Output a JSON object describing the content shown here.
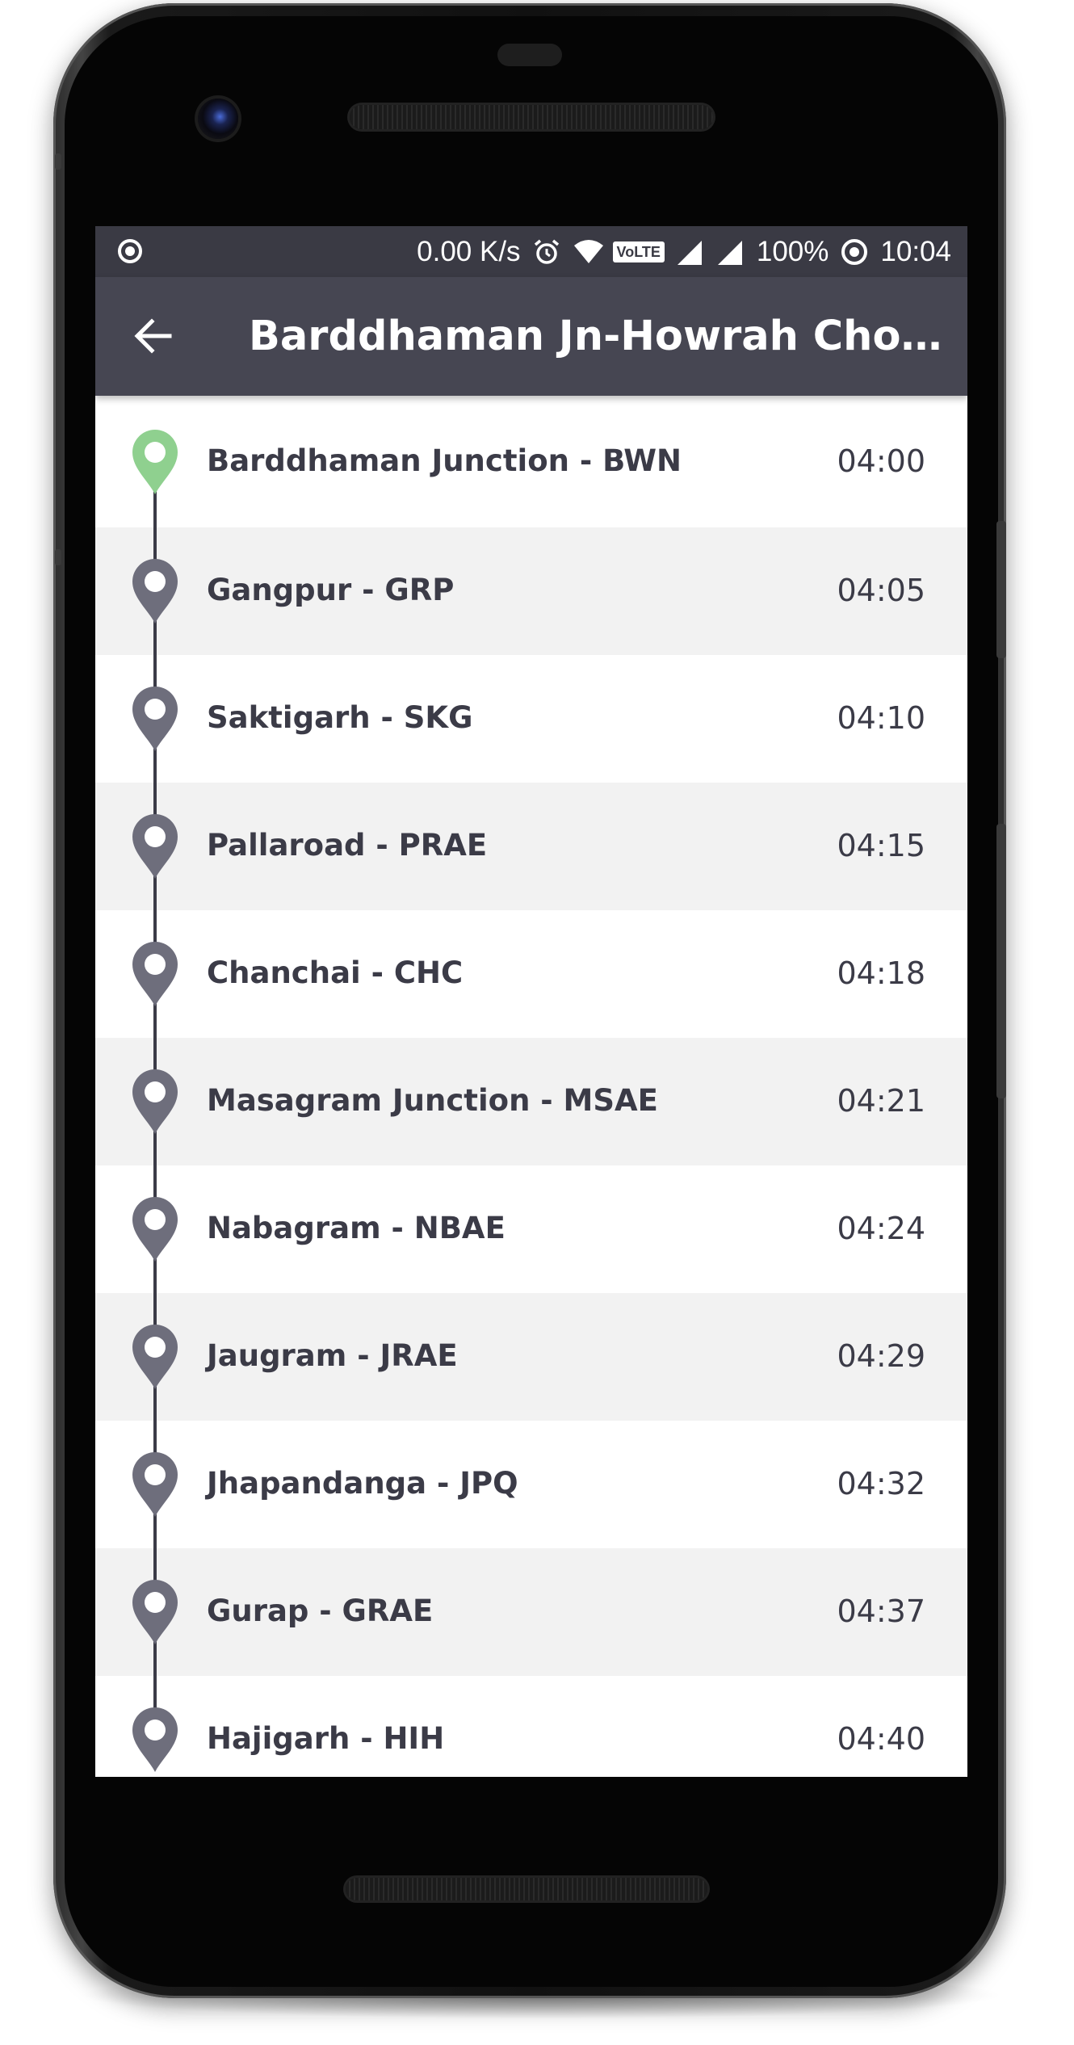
{
  "status_bar": {
    "speed": "0.00 K/s",
    "battery": "100%",
    "time": "10:04",
    "volte": "VoLTE"
  },
  "app_bar": {
    "title": "Barddhaman Jn-Howrah Chord L..."
  },
  "colors": {
    "status_bar": "#3a3a44",
    "app_bar": "#464652",
    "text": "#3b3b47",
    "first_pin": "#8fd08f",
    "pin": "#6e6e7c",
    "row_alt": "#f2f2f2"
  },
  "stations": [
    {
      "name": "Barddhaman Junction - BWN",
      "time": "04:00",
      "current": true
    },
    {
      "name": "Gangpur - GRP",
      "time": "04:05",
      "current": false
    },
    {
      "name": "Saktigarh - SKG",
      "time": "04:10",
      "current": false
    },
    {
      "name": "Pallaroad - PRAE",
      "time": "04:15",
      "current": false
    },
    {
      "name": "Chanchai - CHC",
      "time": "04:18",
      "current": false
    },
    {
      "name": "Masagram Junction - MSAE",
      "time": "04:21",
      "current": false
    },
    {
      "name": "Nabagram - NBAE",
      "time": "04:24",
      "current": false
    },
    {
      "name": "Jaugram - JRAE",
      "time": "04:29",
      "current": false
    },
    {
      "name": "Jhapandanga - JPQ",
      "time": "04:32",
      "current": false
    },
    {
      "name": "Gurap - GRAE",
      "time": "04:37",
      "current": false
    },
    {
      "name": "Hajigarh - HIH",
      "time": "04:40",
      "current": false
    }
  ]
}
